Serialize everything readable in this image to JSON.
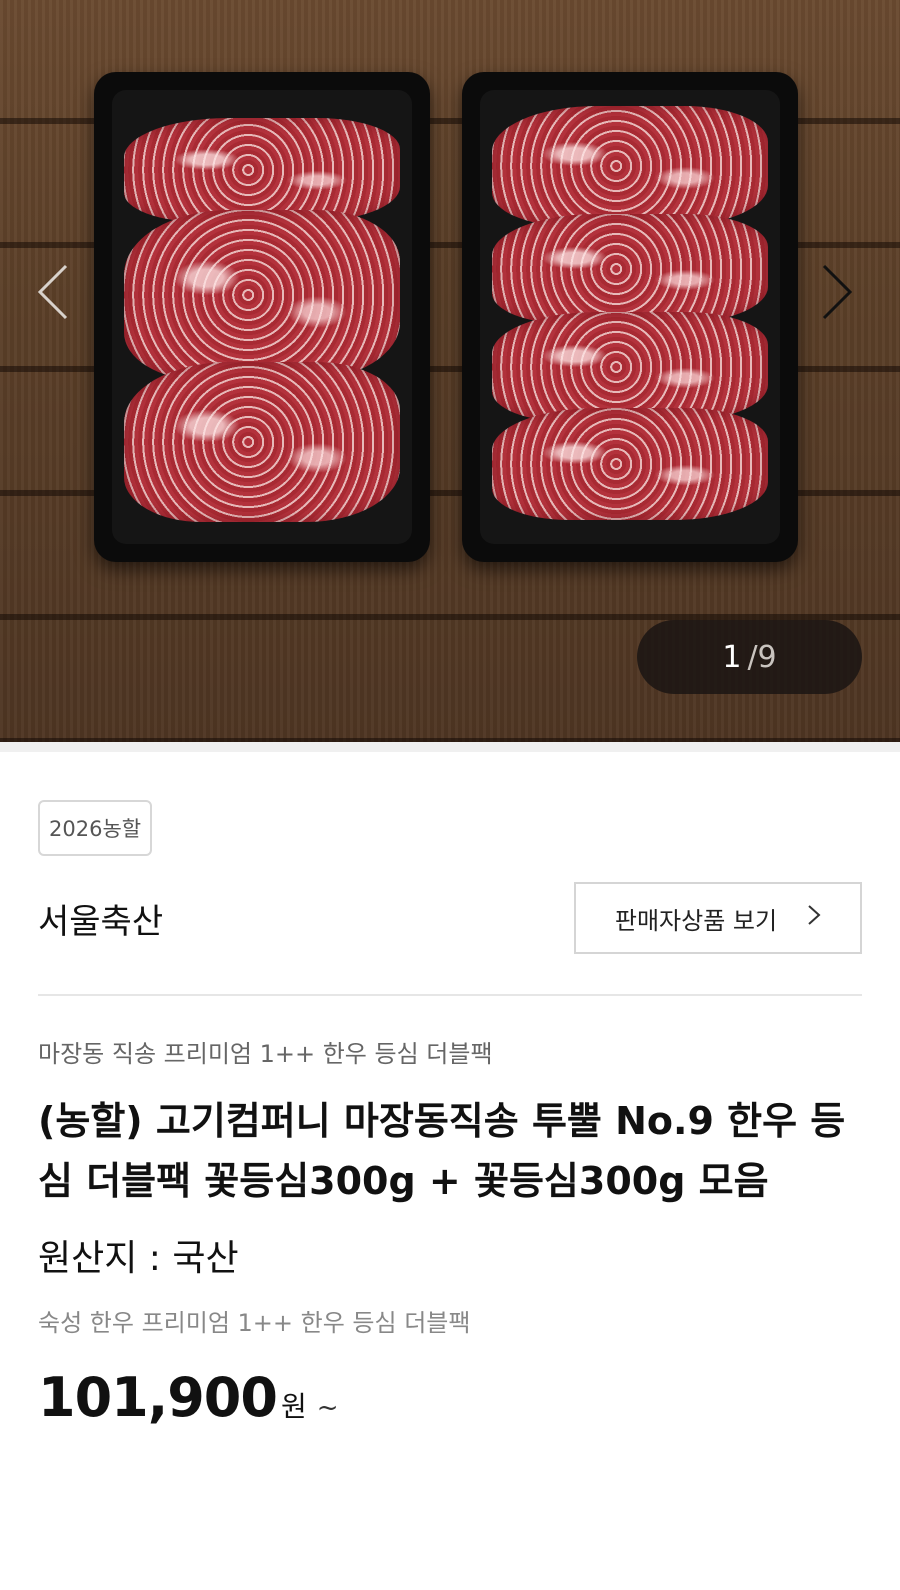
{
  "gallery": {
    "current": "1",
    "total": "/9",
    "prev_icon": "chevron-left-icon",
    "next_icon": "chevron-right-icon"
  },
  "product": {
    "badge": "2026농할",
    "seller": "서울축산",
    "seller_button": "판매자상품 보기",
    "seller_button_icon": "chevron-right-icon",
    "subtitle": "마장동 직송 프리미엄 1++ 한우 등심 더블팩",
    "title": "(농할) 고기컴퍼니 마장동직송 투뿔 No.9 한우 등심 더블팩 꽃등심300g + 꽃등심300g 모음",
    "origin": "원산지 : 국산",
    "description": "숙성 한우 프리미엄 1++ 한우 등심 더블팩",
    "price": "101,900",
    "currency": "원",
    "price_suffix": "~"
  }
}
